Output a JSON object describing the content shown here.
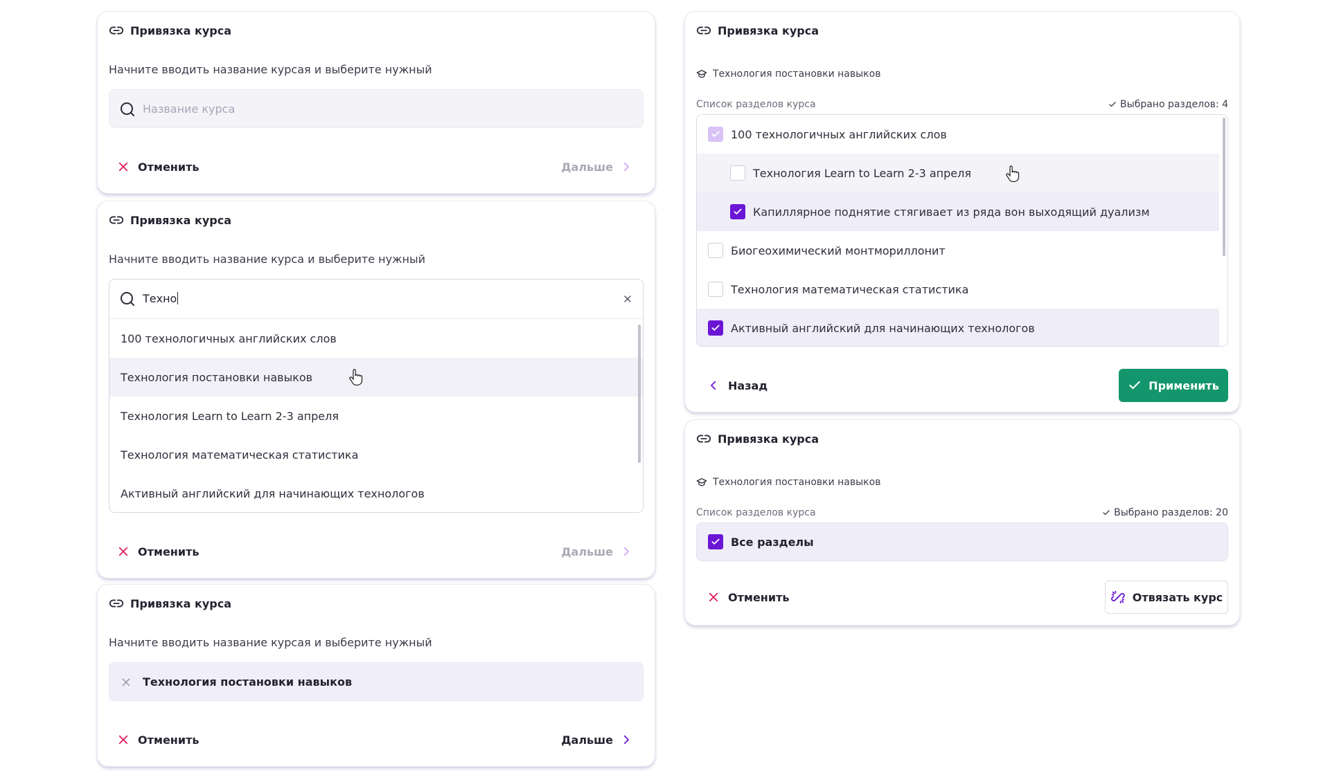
{
  "common": {
    "title": "Привязка курса",
    "hint": "Начните вводить название курсая и выберите нужный",
    "hint_alt": "Начните вводить название курса и выберите нужный",
    "cancel": "Отменить",
    "next": "Дальше",
    "back": "Назад",
    "apply": "Применить",
    "unlink": "Отвязать курс",
    "sections_list_label": "Список разделов курса"
  },
  "colors": {
    "accent": "#6b16d6",
    "cancel_icon": "#e0195c",
    "apply_bg": "#14966c",
    "next_disabled": "#a9a9b5"
  },
  "card_empty": {
    "placeholder": "Название курса"
  },
  "card_search": {
    "value": "Техно",
    "results": [
      "100 технологичных английских слов",
      "Технология постановки навыков",
      "Технология Learn to Learn 2-3 апреля",
      "Технология математическая статистика",
      "Активный английский для начинающих технологов"
    ]
  },
  "card_selected": {
    "value": "Технология постановки навыков"
  },
  "card_sections": {
    "course": "Технология постановки навыков",
    "count_label": "Выбрано разделов: 4",
    "items": [
      {
        "label": "100 технологичных английских слов",
        "state": "partial",
        "level": 0
      },
      {
        "label": "Технология Learn to Learn 2-3 апреля",
        "state": "off",
        "level": 1
      },
      {
        "label": "Капиллярное поднятие стягивает из ряда вон выходящий дуализм",
        "state": "on",
        "level": 1
      },
      {
        "label": "Биогеохимический монтмориллонит",
        "state": "off",
        "level": 0
      },
      {
        "label": "Технология математическая статистика",
        "state": "off",
        "level": 0
      },
      {
        "label": "Активный английский для начинающих технологов",
        "state": "on",
        "level": 0
      }
    ]
  },
  "card_all": {
    "course": "Технология постановки навыков",
    "count_label": "Выбрано разделов: 20",
    "all_label": "Все разделы"
  }
}
